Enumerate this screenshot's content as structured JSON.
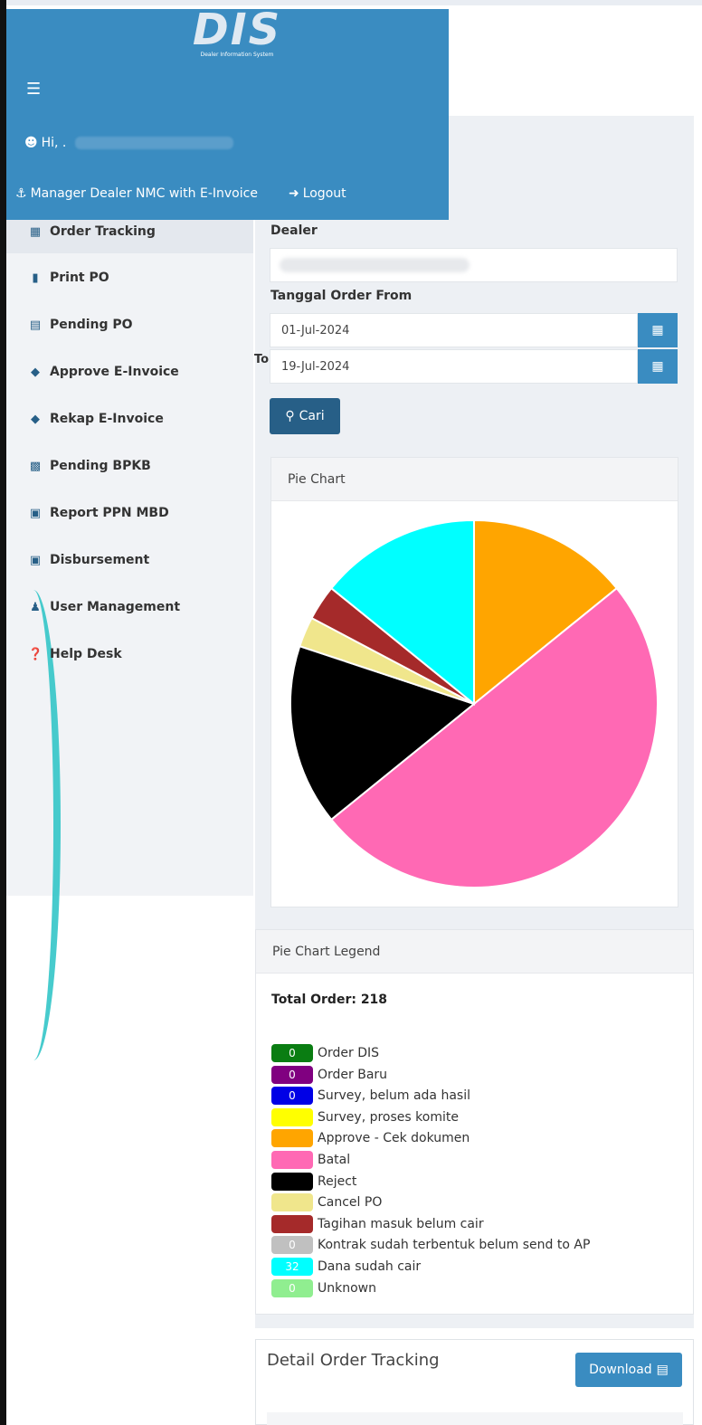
{
  "header": {
    "logo_text": "DIS",
    "logo_subtitle": "Dealer Information System",
    "menu_icon": "hamburger-icon",
    "greeting": "Hi, .",
    "role": "Manager Dealer NMC with E-Invoice",
    "logout": "Logout"
  },
  "sidebar": {
    "items": [
      {
        "label": "Order Tracking",
        "icon": "map-icon",
        "active": true
      },
      {
        "label": "Print PO",
        "icon": "book-icon"
      },
      {
        "label": "Pending PO",
        "icon": "file-icon"
      },
      {
        "label": "Approve E-Invoice",
        "icon": "tag-icon"
      },
      {
        "label": "Rekap E-Invoice",
        "icon": "tag-icon"
      },
      {
        "label": "Pending BPKB",
        "icon": "id-card-icon"
      },
      {
        "label": "Report PPN MBD",
        "icon": "money-icon"
      },
      {
        "label": "Disbursement",
        "icon": "money-icon"
      },
      {
        "label": "User Management",
        "icon": "user-plus-icon"
      },
      {
        "label": "Help Desk",
        "icon": "question-icon"
      }
    ]
  },
  "form": {
    "dealer_label": "Dealer",
    "date_label": "Tanggal Order From",
    "date_from": "01-Jul-2024",
    "to_label": "To",
    "date_to": "19-Jul-2024",
    "search_button": "Cari"
  },
  "pie_card": {
    "title": "Pie Chart"
  },
  "legend_card": {
    "title": "Pie Chart Legend",
    "total_label": "Total Order: 218",
    "items": [
      {
        "label": "Order DIS",
        "count": "0",
        "color": "#0a7d12"
      },
      {
        "label": "Order Baru",
        "count": "0",
        "color": "#800080"
      },
      {
        "label": "Survey, belum ada hasil",
        "count": "0",
        "color": "#0000e6"
      },
      {
        "label": "Survey, proses komite",
        "count": "",
        "color": "#ffff00"
      },
      {
        "label": "Approve - Cek dokumen",
        "count": "",
        "color": "#ffa500"
      },
      {
        "label": "Batal",
        "count": "",
        "color": "#ff69b4"
      },
      {
        "label": "Reject",
        "count": "",
        "color": "#000000"
      },
      {
        "label": "Cancel PO",
        "count": "",
        "color": "#f0e68c"
      },
      {
        "label": "Tagihan masuk belum cair",
        "count": "",
        "color": "#a52a2a"
      },
      {
        "label": "Kontrak sudah terbentuk belum send to AP",
        "count": "0",
        "color": "#c0c0c0"
      },
      {
        "label": "Dana sudah cair",
        "count": "32",
        "color": "#00ffff"
      },
      {
        "label": "Unknown",
        "count": "0",
        "color": "#90ee90"
      }
    ]
  },
  "detail": {
    "title": "Detail Order Tracking",
    "download": "Download"
  },
  "chart_data": {
    "type": "pie",
    "categories": [
      "Approve - Cek dokumen",
      "Batal",
      "Reject",
      "Cancel PO",
      "Tagihan masuk belum cair",
      "Dana sudah cair"
    ],
    "values": [
      32,
      113,
      36,
      6,
      7,
      32
    ],
    "colors": [
      "#ffa500",
      "#ff69b4",
      "#000000",
      "#f0e68c",
      "#a52a2a",
      "#00ffff"
    ],
    "title": "",
    "total": 218
  }
}
